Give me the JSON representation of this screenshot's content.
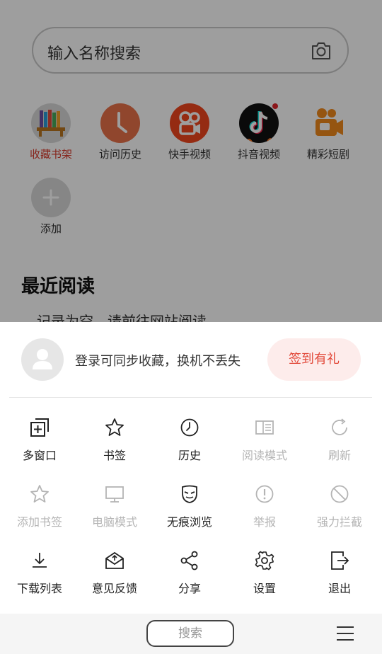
{
  "search": {
    "placeholder": "输入名称搜索"
  },
  "apps": [
    {
      "label": "收藏书架",
      "icon": "bookshelf-icon",
      "color": "#d93a2c"
    },
    {
      "label": "访问历史",
      "icon": "clock-icon"
    },
    {
      "label": "快手视频",
      "icon": "kuaishou-icon"
    },
    {
      "label": "抖音视频",
      "icon": "douyin-icon"
    },
    {
      "label": "精彩短剧",
      "icon": "video-camera-icon"
    },
    {
      "label": "添加",
      "icon": "plus-icon"
    }
  ],
  "recent": {
    "title": "最近阅读",
    "empty_text": "记录为空，请前往网站阅读"
  },
  "sheet": {
    "login_text": "登录可同步收藏，换机不丢失",
    "signin_label": "签到有礼",
    "menu": [
      {
        "label": "多窗口",
        "icon": "multi-window-icon",
        "enabled": true
      },
      {
        "label": "书签",
        "icon": "star-icon",
        "enabled": true
      },
      {
        "label": "历史",
        "icon": "clock-icon",
        "enabled": true
      },
      {
        "label": "阅读模式",
        "icon": "reading-mode-icon",
        "enabled": false
      },
      {
        "label": "刷新",
        "icon": "refresh-icon",
        "enabled": false
      },
      {
        "label": "添加书签",
        "icon": "star-icon",
        "enabled": false
      },
      {
        "label": "电脑模式",
        "icon": "monitor-icon",
        "enabled": false
      },
      {
        "label": "无痕浏览",
        "icon": "mask-icon",
        "enabled": true
      },
      {
        "label": "举报",
        "icon": "exclamation-icon",
        "enabled": false
      },
      {
        "label": "强力拦截",
        "icon": "block-icon",
        "enabled": false
      },
      {
        "label": "下载列表",
        "icon": "download-icon",
        "enabled": true
      },
      {
        "label": "意见反馈",
        "icon": "feedback-mail-icon",
        "enabled": true
      },
      {
        "label": "分享",
        "icon": "share-icon",
        "enabled": true
      },
      {
        "label": "设置",
        "icon": "gear-icon",
        "enabled": true
      },
      {
        "label": "退出",
        "icon": "exit-icon",
        "enabled": true
      }
    ]
  },
  "bottom_bar": {
    "search_label": "搜索"
  }
}
